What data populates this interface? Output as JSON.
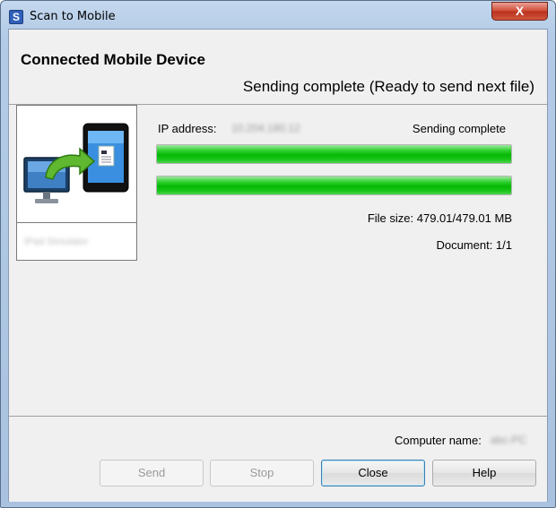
{
  "window": {
    "title": "Scan to Mobile",
    "close_glyph": "X",
    "app_icon_glyph": "S"
  },
  "header": {
    "title": "Connected Mobile Device",
    "status": "Sending complete (Ready to send next file)"
  },
  "device": {
    "name": "iPad Simulator",
    "icon": "computer-to-tablet-icon"
  },
  "transfer": {
    "ip_label": "IP address:",
    "ip_value": "10.204.180.12",
    "status": "Sending complete",
    "progress_1": 1.0,
    "progress_2": 1.0,
    "file_size": "File size: 479.01/479.01 MB",
    "document": "Document: 1/1"
  },
  "footer": {
    "computer_label": "Computer name:",
    "computer_value": "abc-PC"
  },
  "buttons": {
    "send": "Send",
    "stop": "Stop",
    "close": "Close",
    "help": "Help"
  },
  "colors": {
    "progress_green": "#06b806",
    "close_red": "#d04a33",
    "window_frame": "#b3cbe6"
  }
}
